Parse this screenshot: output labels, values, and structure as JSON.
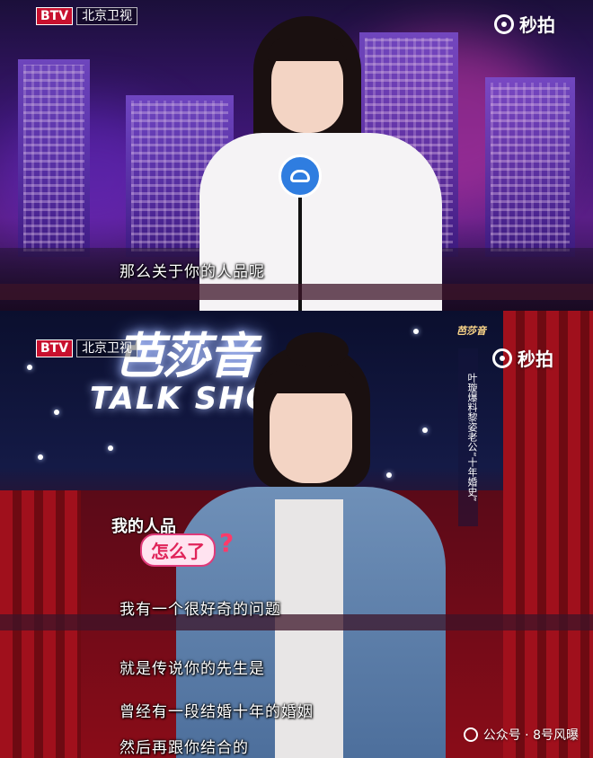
{
  "top_panel": {
    "channel_box": "BTV",
    "channel_name": "北京卫视",
    "app_logo_text": "秒拍",
    "subtitle": "那么关于你的人品呢"
  },
  "bottom_panel": {
    "channel_box": "BTV",
    "channel_name": "北京卫视",
    "app_logo_text": "秒拍",
    "show_sign_title": "芭莎音",
    "show_sign_subtitle": "TALK SHOW",
    "banner_badge": "芭莎音",
    "vertical_banner": "叶璇爆料黎姿老公“十年婚史”",
    "sticker_line1": "我的人品",
    "sticker_line2": "怎么了",
    "sticker_mark": "?",
    "subtitles": [
      "我有一个很好奇的问题",
      "就是传说你的先生是",
      "曾经有一段结婚十年的婚姻",
      "然后再跟你结合的"
    ]
  },
  "watermark": {
    "text": "公众号 · 8号风曝",
    "icon": "wechat-icon"
  },
  "colors": {
    "btv_red": "#c8102e",
    "sticker_pink": "#e0245a"
  }
}
